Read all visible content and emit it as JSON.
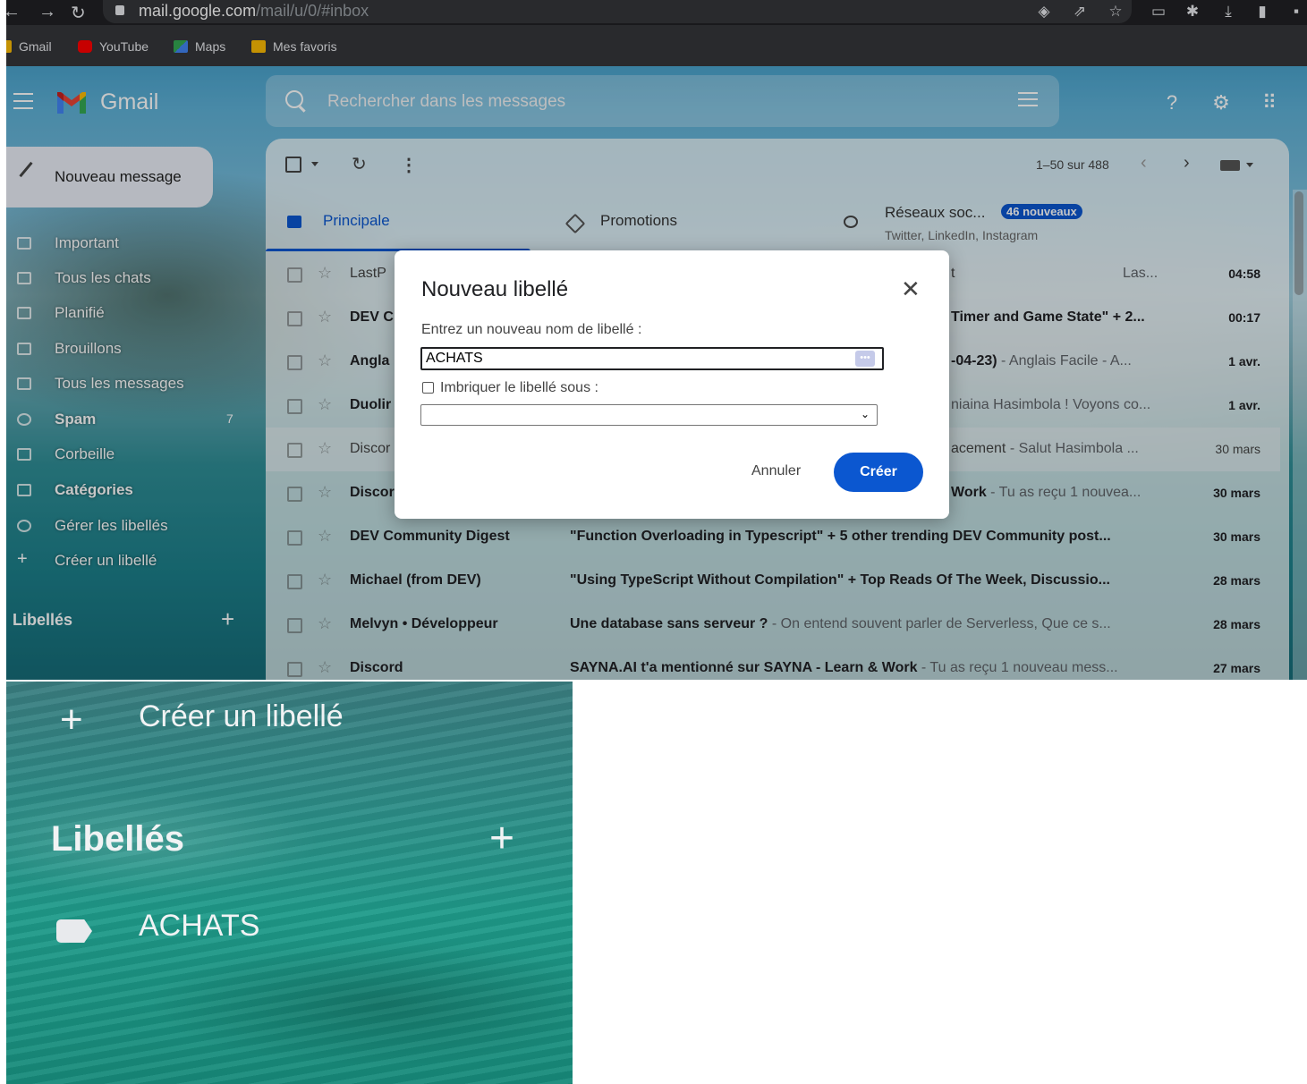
{
  "browser": {
    "url_host": "mail.google.com",
    "url_path": "/mail/u/0/#inbox",
    "bookmarks": [
      {
        "label": "Gmail",
        "color": "#ea4335"
      },
      {
        "label": "YouTube",
        "color": "#ff0000"
      },
      {
        "label": "Maps",
        "color": "#34a853"
      },
      {
        "label": "Mes favoris",
        "color": "#fbbc04"
      }
    ]
  },
  "header": {
    "app_name": "Gmail",
    "search_placeholder": "Rechercher dans les messages"
  },
  "sidebar": {
    "compose_label": "Nouveau message",
    "items": [
      {
        "label": "Important"
      },
      {
        "label": "Tous les chats"
      },
      {
        "label": "Planifié"
      },
      {
        "label": "Brouillons"
      },
      {
        "label": "Tous les messages"
      },
      {
        "label": "Spam",
        "count": "7"
      },
      {
        "label": "Corbeille"
      },
      {
        "label": "Catégories"
      },
      {
        "label": "Gérer les libellés"
      },
      {
        "label": "Créer un libellé"
      }
    ],
    "labels_heading": "Libellés"
  },
  "toolbar": {
    "pager": "1–50 sur 488"
  },
  "tabs": [
    {
      "label": "Principale"
    },
    {
      "label": "Promotions"
    },
    {
      "label": "Réseaux soc...",
      "badge": "46 nouveaux",
      "sub": "Twitter, LinkedIn, Instagram"
    }
  ],
  "emails": [
    {
      "sender": "LastP",
      "subject": "t",
      "snippet": "Las...",
      "date": "04:58"
    },
    {
      "sender": "DEV C",
      "subject": "Timer and Game State\" + 2...",
      "snippet": "",
      "date": "00:17"
    },
    {
      "sender": "Angla",
      "subject": "-04-23)",
      "snippet": " - Anglais Facile - A...",
      "date": "1 avr."
    },
    {
      "sender": "Duolir",
      "subject": "",
      "snippet": "niaina Hasimbola ! Voyons co...",
      "date": "1 avr."
    },
    {
      "sender": "Discor",
      "subject": "acement",
      "snippet": " - Salut Hasimbola ...",
      "date": "30 mars"
    },
    {
      "sender": "Discor",
      "subject": "Work",
      "snippet": " - Tu as reçu 1 nouvea...",
      "date": "30 mars"
    },
    {
      "sender": "DEV Community Digest",
      "subject": "\"Function Overloading in Typescript\" + 5 other trending DEV Community post...",
      "snippet": "",
      "date": "30 mars"
    },
    {
      "sender": "Michael (from DEV)",
      "subject": "\"Using TypeScript Without Compilation\" + Top Reads Of The Week, Discussio...",
      "snippet": "",
      "date": "28 mars"
    },
    {
      "sender": "Melvyn • Développeur",
      "subject": "Une database sans serveur ?",
      "snippet": " - On entend souvent parler de Serverless, Que ce s...",
      "date": "28 mars"
    },
    {
      "sender": "Discord",
      "subject": "SAYNA.AI t'a mentionné sur SAYNA - Learn & Work",
      "snippet": " - Tu as reçu 1 nouveau mess...",
      "date": "27 mars"
    }
  ],
  "dialog": {
    "title": "Nouveau libellé",
    "prompt": "Entrez un nouveau nom de libellé :",
    "name_value": "ACHATS",
    "nest_label": "Imbriquer le libellé sous :",
    "cancel_label": "Annuler",
    "create_label": "Créer"
  },
  "zoom": {
    "create_label": "Créer un libellé",
    "labels_heading": "Libellés",
    "new_label": "ACHATS"
  },
  "colors": {
    "accent": "#0b57d0"
  }
}
